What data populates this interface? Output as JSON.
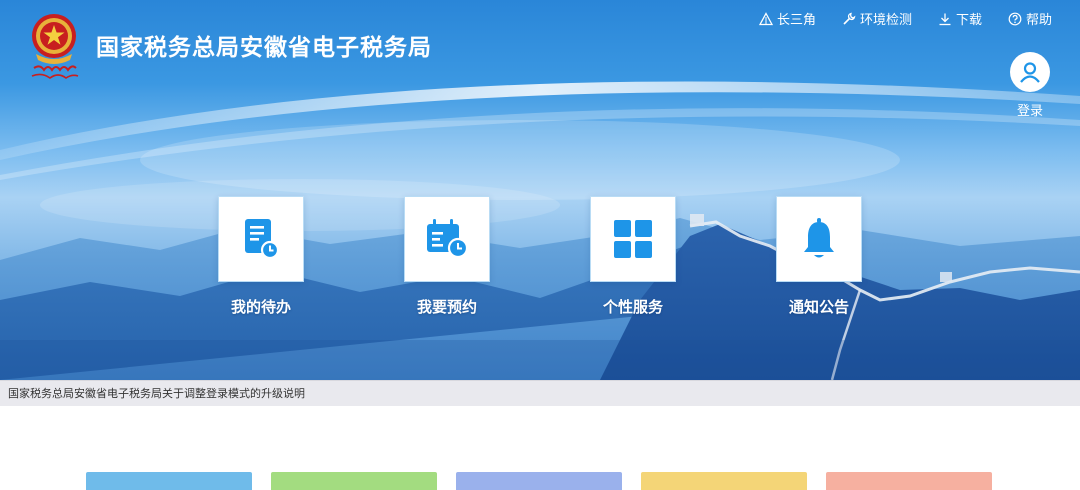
{
  "header": {
    "title": "国家税务总局安徽省电子税务局",
    "links": [
      {
        "label": "长三角",
        "icon": "triangle-icon"
      },
      {
        "label": "环境检测",
        "icon": "wrench-icon"
      },
      {
        "label": "下载",
        "icon": "download-icon"
      },
      {
        "label": "帮助",
        "icon": "help-icon"
      }
    ],
    "login_label": "登录"
  },
  "services": [
    {
      "label": "我的待办",
      "icon": "todo-list-icon"
    },
    {
      "label": "我要预约",
      "icon": "calendar-clock-icon"
    },
    {
      "label": "个性服务",
      "icon": "grid-icon"
    },
    {
      "label": "通知公告",
      "icon": "bell-icon"
    }
  ],
  "notice": {
    "text": "国家税务总局安徽省电子税务局关于调整登录模式的升级说明"
  },
  "cards": [
    {
      "color": "#6fbbea"
    },
    {
      "color": "#a3dc80"
    },
    {
      "color": "#9ab1ec"
    },
    {
      "color": "#f4d577"
    },
    {
      "color": "#f6b0a0"
    }
  ],
  "theme": {
    "accent": "#1e95e8",
    "banner_top": "#2a86d8"
  }
}
